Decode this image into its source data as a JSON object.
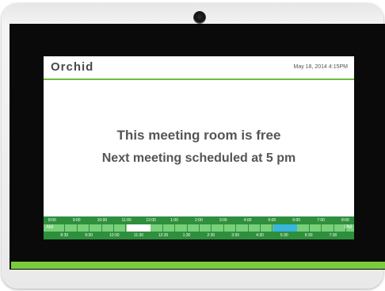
{
  "header": {
    "brand": "Orchid",
    "datetime": "May 18, 2014 4:15PM"
  },
  "status": {
    "line1": "This meeting room is free",
    "line2": "Next meeting scheduled at 5 pm"
  },
  "timeline": {
    "start_label": "AM",
    "end_label": "PM",
    "top_times": [
      "8:00",
      "9:00",
      "10:00",
      "11:00",
      "12:00",
      "1:00",
      "2:00",
      "3:00",
      "4:00",
      "5:00",
      "6:00",
      "7:00",
      "8:00"
    ],
    "bottom_times": [
      "8:30",
      "9:30",
      "10:30",
      "11:30",
      "12:30",
      "1:30",
      "2:30",
      "3:30",
      "4:30",
      "5:30",
      "6:30",
      "7:30"
    ],
    "highlights": [
      {
        "kind": "selected",
        "from_hour": 11.0,
        "to_hour": 12.0,
        "color": "#ffffff"
      },
      {
        "kind": "scheduled",
        "from_hour": 17.0,
        "to_hour": 18.0,
        "color": "#38b6e0"
      }
    ]
  },
  "colors": {
    "accent": "#6dbe3a",
    "timeline_bg": "#2e8f3d",
    "timeline_bar": "#79d07a",
    "brand_text": "#4a4a4a"
  }
}
